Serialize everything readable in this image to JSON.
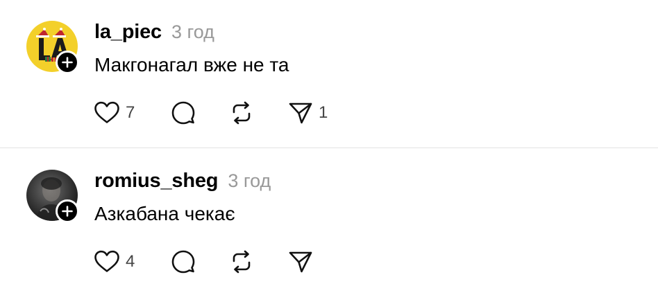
{
  "posts": [
    {
      "username": "la_piec",
      "time": "3 год",
      "text": "Макгонагал вже не та",
      "avatar_bg": "#f3d02a",
      "avatar_letters": "LA",
      "likes": "7",
      "shares": "1"
    },
    {
      "username": "romius_sheg",
      "time": "3 год",
      "text": "Азкабана чекає",
      "likes": "4",
      "shares": ""
    }
  ],
  "icons": [
    "heart-icon",
    "comment-icon",
    "repost-icon",
    "share-icon",
    "plus-icon"
  ],
  "colors": {
    "text": "#000000",
    "muted": "#999999",
    "divider": "#e3e3e3"
  }
}
